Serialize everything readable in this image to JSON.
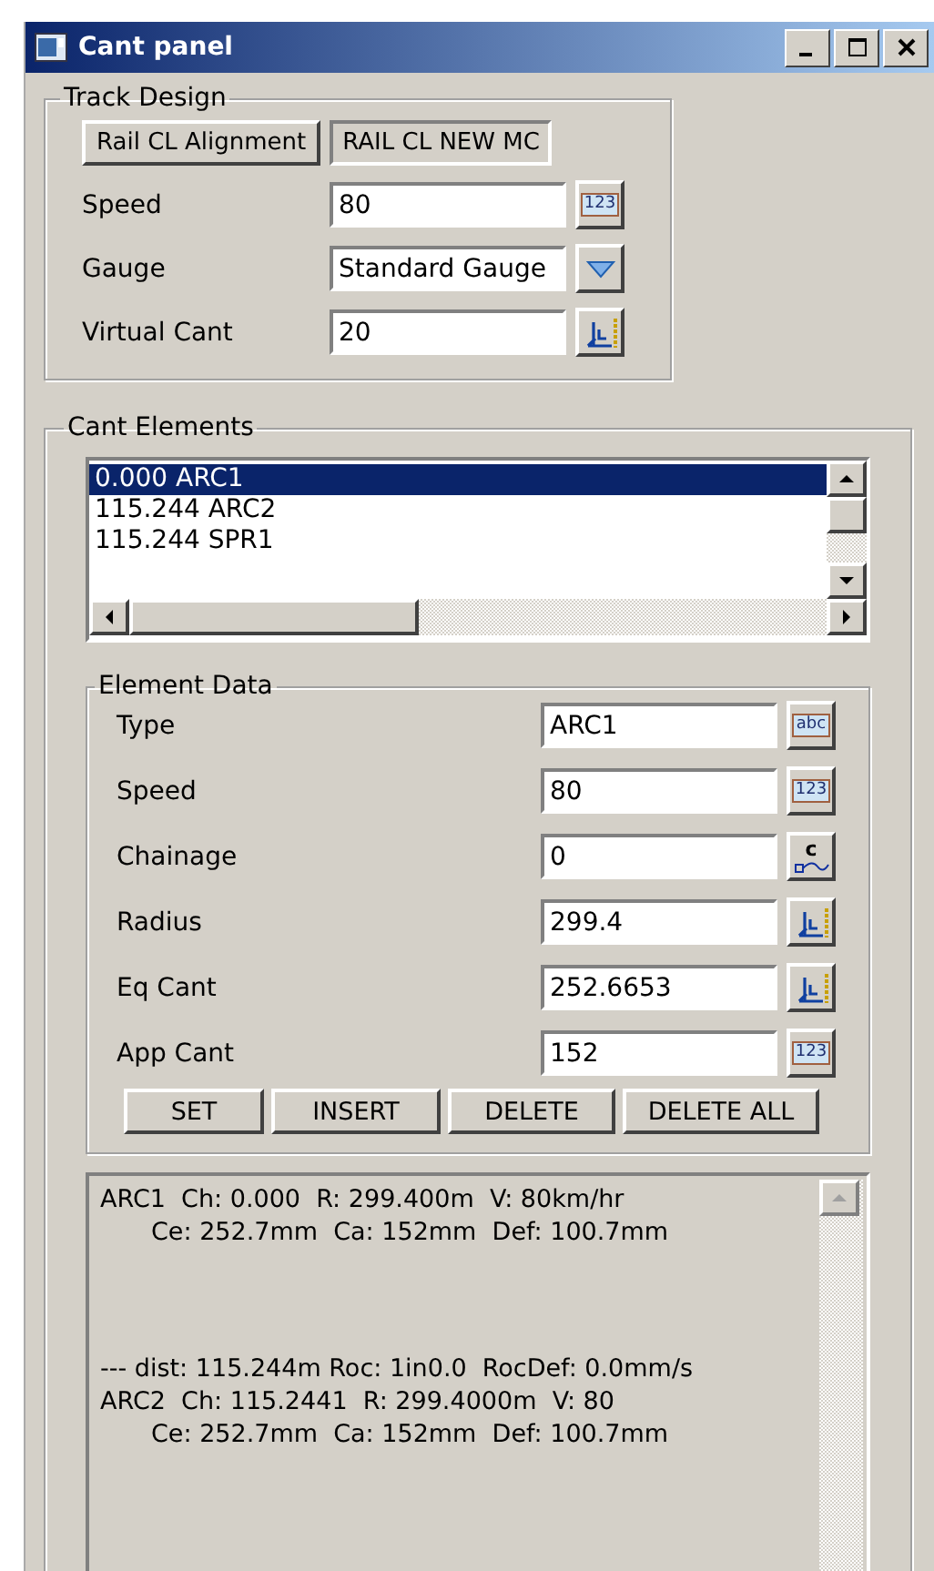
{
  "window": {
    "title": "Cant panel"
  },
  "track_design": {
    "title": "Track Design",
    "alignment_button": "Rail CL Alignment",
    "alignment_value": "RAIL CL NEW MC",
    "fields": [
      {
        "label": "Speed",
        "value": "80",
        "button": {
          "kind": "number",
          "text": "123"
        }
      },
      {
        "label": "Gauge",
        "value": "Standard Gauge",
        "button": {
          "kind": "dropdown"
        }
      },
      {
        "label": "Virtual Cant",
        "value": "20",
        "button": {
          "kind": "pick"
        }
      }
    ]
  },
  "cant_elements": {
    "title": "Cant Elements",
    "items": [
      {
        "text": "0.000 ARC1",
        "selected": true
      },
      {
        "text": "115.244 ARC2",
        "selected": false
      },
      {
        "text": "115.244 SPR1",
        "selected": false
      }
    ],
    "element_data": {
      "title": "Element Data",
      "fields": [
        {
          "label": "Type",
          "value": "ARC1",
          "button": {
            "kind": "text",
            "text": "abc"
          }
        },
        {
          "label": "Speed",
          "value": "80",
          "button": {
            "kind": "number",
            "text": "123"
          }
        },
        {
          "label": "Chainage",
          "value": "0",
          "button": {
            "kind": "chainage",
            "text": "c"
          }
        },
        {
          "label": "Radius",
          "value": "299.4",
          "button": {
            "kind": "pick"
          }
        },
        {
          "label": "Eq Cant",
          "value": "252.6653",
          "button": {
            "kind": "pick"
          }
        },
        {
          "label": "App Cant",
          "value": "152",
          "button": {
            "kind": "number",
            "text": "123"
          }
        }
      ],
      "buttons": [
        "SET",
        "INSERT",
        "DELETE",
        "DELETE ALL"
      ]
    },
    "report": [
      {
        "lines": [
          {
            "text": "ARC1  Ch: 0.000  R: 299.400m  V: 80km/hr",
            "indented": false
          },
          {
            "text": "Ce: 252.7mm  Ca: 152mm  Def: 100.7mm",
            "indented": true
          }
        ]
      },
      {
        "lines": [
          {
            "text": "--- dist: 115.244m Roc: 1in0.0  RocDef: 0.0mm/s",
            "indented": false
          },
          {
            "text": "ARC2  Ch: 115.2441  R: 299.4000m  V: 80",
            "indented": false
          },
          {
            "text": "Ce: 252.7mm  Ca: 152mm  Def: 100.7mm",
            "indented": true
          }
        ]
      }
    ]
  }
}
